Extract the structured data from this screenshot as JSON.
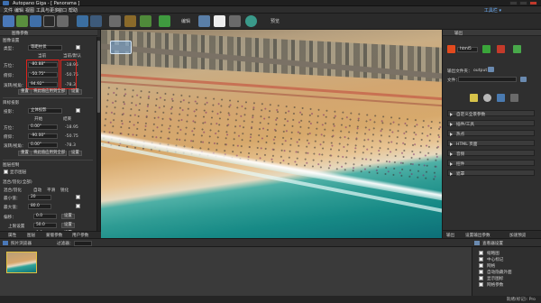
{
  "window": {
    "title": "Autopano Giga - [ Panorama ]"
  },
  "menu": {
    "items": [
      "文件",
      "编辑",
      "视图",
      "工具与更多",
      "窗口",
      "帮助"
    ],
    "toolbox_label": "工具栏 ▾"
  },
  "toolbar": {
    "label_a": "编辑",
    "label_b": "预览"
  },
  "left_panel": {
    "title": "图像参数",
    "group1_title": "图像设置",
    "type_label": "类型：",
    "type_value": "等距柱状",
    "col_current": "当前",
    "col_default": "当前/默认",
    "rows": [
      {
        "label": "方位：",
        "value": "-80.88°",
        "default": "-18.95"
      },
      {
        "label": "俯仰：",
        "value": "-50.75°",
        "default": "-50.75"
      },
      {
        "label": "滚转/视角：",
        "value": "94.92°",
        "default": "-78.3"
      }
    ],
    "reset_label": "重置",
    "apply_label": "将此值应用到全部",
    "apply_btn": "设置",
    "group2_title": "目标投影",
    "proj_label": "投影：",
    "proj_value": "立体投影",
    "col_start": "开始",
    "col_end": "结束",
    "rows2": [
      {
        "label": "方位：",
        "value": "0.00°",
        "default": "-18.95"
      },
      {
        "label": "俯仰：",
        "value": "-90.00°",
        "default": "-50.75"
      },
      {
        "label": "滚转/视角：",
        "value": "0.00°",
        "default": "-78.3"
      }
    ],
    "reset2_label": "重置",
    "apply2_label": "将此值应用到全部",
    "apply2_btn": "设置",
    "layer_title": "图层控制",
    "layer_check": "显示图层",
    "blend_title": "混合/羽化(全部)",
    "blend_label": "混合/羽化",
    "blend_opts": [
      "自动",
      "平滑",
      "锐化"
    ],
    "min_label": "最小值：",
    "max_label": "最大值：",
    "shift_label": "偏移：",
    "limit_label": "上限设置",
    "limit2_label": "下限设置",
    "set_btn": "设置",
    "field_vals": [
      "20",
      "80.0",
      "0.0",
      "50.0",
      "0.0"
    ],
    "tabs": [
      "属性",
      "图层",
      "蒙版参数",
      "用户参数"
    ]
  },
  "right_panel": {
    "title": "输出",
    "format_value": "html5",
    "dest_label": "输出文件夹：",
    "dest_value": "output",
    "file_label": "文件：",
    "sections": [
      "自定义全景参数",
      "插件/工具",
      "热点",
      "HTML 页面",
      "音频",
      "控件",
      "遮罩"
    ],
    "tabs": [
      "输出",
      "设置输出参数",
      "加速预览"
    ]
  },
  "bottom": {
    "panel_label": "照片浏览器",
    "filter_label": "过滤器：",
    "right_label": "查看器设置",
    "options": [
      "缩略图",
      "中心标记",
      "网格",
      "自动隐藏外面",
      "显示图标",
      "网格参数"
    ]
  },
  "status": {
    "text": "就绪(标记): Pro"
  },
  "colors": {
    "accent": "#3d6fb0",
    "highlight_red": "#e0211b",
    "panel": "#2f2f2f"
  }
}
